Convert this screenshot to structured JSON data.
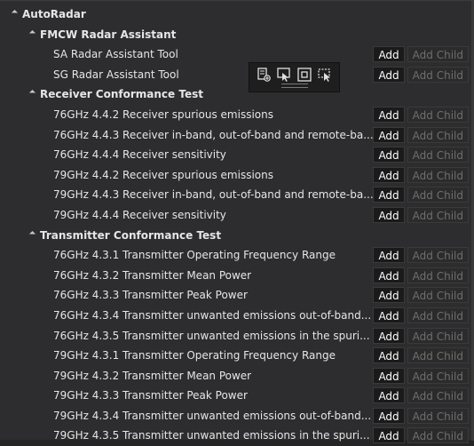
{
  "tree": {
    "root": {
      "label": "AutoRadar"
    },
    "groups": [
      {
        "label": "FMCW Radar Assistant",
        "items": [
          {
            "label": "SA Radar Assistant Tool",
            "add": "Add",
            "add_child": "Add Child"
          },
          {
            "label": "SG Radar Assistant Tool",
            "add": "Add",
            "add_child": "Add Child"
          }
        ]
      },
      {
        "label": "Receiver Conformance Test",
        "items": [
          {
            "label": "76GHz 4.4.2 Receiver spurious emissions",
            "add": "Add",
            "add_child": "Add Child"
          },
          {
            "label": "76GHz 4.4.3 Receiver in-band, out-of-band and remote-ba...",
            "add": "Add",
            "add_child": "Add Child"
          },
          {
            "label": "76GHz 4.4.4 Receiver sensitivity",
            "add": "Add",
            "add_child": "Add Child"
          },
          {
            "label": "79GHz 4.4.2 Receiver spurious emissions",
            "add": "Add",
            "add_child": "Add Child"
          },
          {
            "label": "79GHz 4.4.3 Receiver in-band, out-of-band and remote-ba...",
            "add": "Add",
            "add_child": "Add Child"
          },
          {
            "label": "79GHz 4.4.4 Receiver sensitivity",
            "add": "Add",
            "add_child": "Add Child"
          }
        ]
      },
      {
        "label": "Transmitter Conformance Test",
        "items": [
          {
            "label": "76GHz 4.3.1 Transmitter Operating Frequency Range",
            "add": "Add",
            "add_child": "Add Child"
          },
          {
            "label": "76GHz 4.3.2 Transmitter Mean Power",
            "add": "Add",
            "add_child": "Add Child"
          },
          {
            "label": "76GHz 4.3.3 Transmitter Peak Power",
            "add": "Add",
            "add_child": "Add Child"
          },
          {
            "label": "76GHz 4.3.4 Transmitter unwanted emissions out-of-band...",
            "add": "Add",
            "add_child": "Add Child"
          },
          {
            "label": "76GHz 4.3.5 Transmitter unwanted emissions in the spuri...",
            "add": "Add",
            "add_child": "Add Child"
          },
          {
            "label": "79GHz 4.3.1 Transmitter Operating Frequency Range",
            "add": "Add",
            "add_child": "Add Child"
          },
          {
            "label": "79GHz 4.3.2 Transmitter Mean Power",
            "add": "Add",
            "add_child": "Add Child"
          },
          {
            "label": "79GHz 4.3.3 Transmitter Peak Power",
            "add": "Add",
            "add_child": "Add Child"
          },
          {
            "label": "79GHz 4.3.4 Transmitter unwanted emissions out-of-band...",
            "add": "Add",
            "add_child": "Add Child"
          },
          {
            "label": "79GHz 4.3.5 Transmitter unwanted emissions in the spuri...",
            "add": "Add",
            "add_child": "Add Child"
          }
        ]
      }
    ]
  },
  "floating_toolbar": {
    "icons": [
      "add-element-icon",
      "select-pointer-icon",
      "select-frame-icon",
      "inspect-element-icon"
    ]
  },
  "colors": {
    "background": "#2d2d30",
    "text": "#e6e6e6",
    "button_bg": "#1a1a1a",
    "button_disabled_text": "#6e6e6e"
  }
}
